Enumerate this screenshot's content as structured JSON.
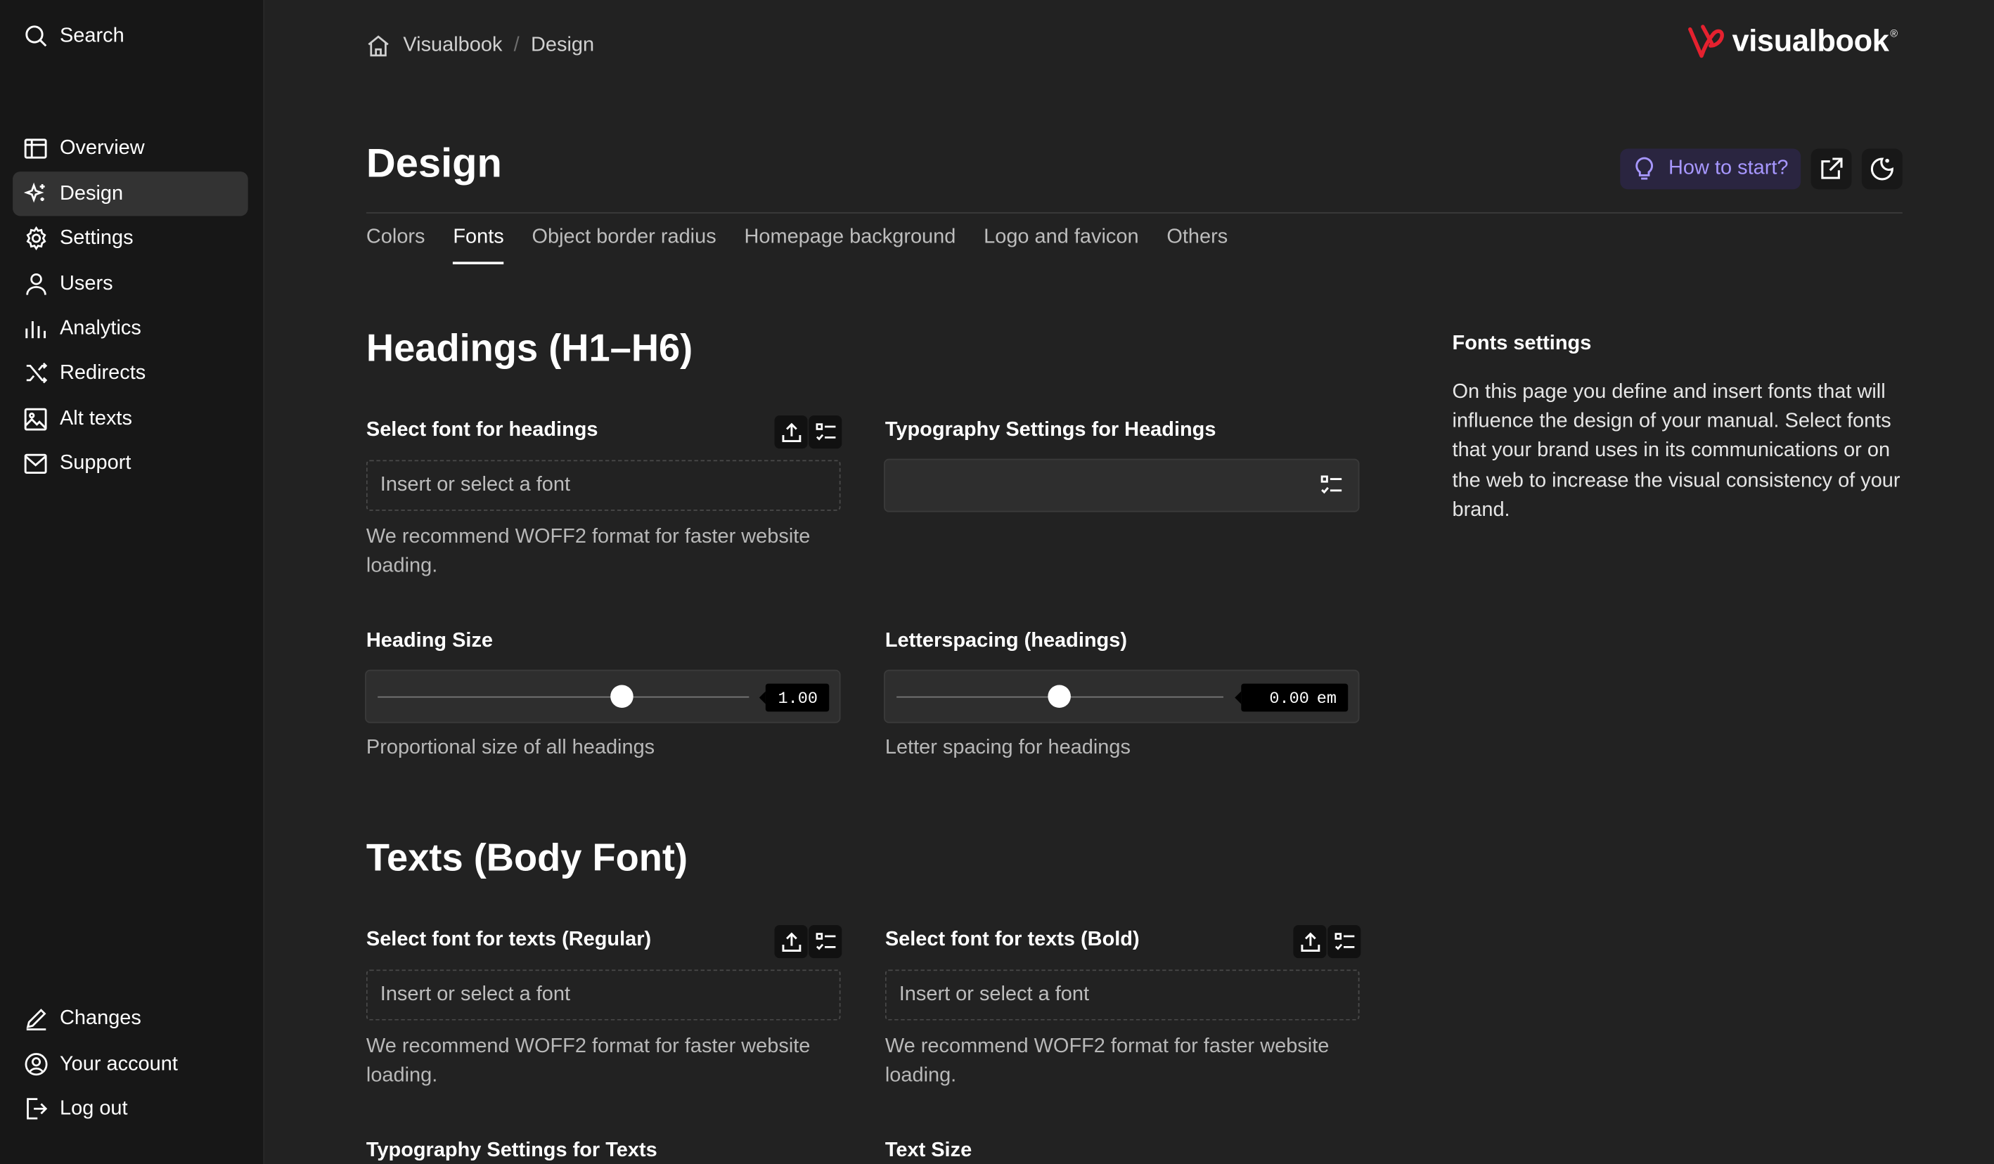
{
  "sidebar": {
    "search_label": "Search",
    "nav": [
      {
        "label": "Overview",
        "icon": "overview-icon"
      },
      {
        "label": "Design",
        "icon": "sparkle-icon",
        "active": true
      },
      {
        "label": "Settings",
        "icon": "gear-icon"
      },
      {
        "label": "Users",
        "icon": "user-icon"
      },
      {
        "label": "Analytics",
        "icon": "bar-chart-icon"
      },
      {
        "label": "Redirects",
        "icon": "shuffle-icon"
      },
      {
        "label": "Alt texts",
        "icon": "image-icon"
      },
      {
        "label": "Support",
        "icon": "mail-icon"
      }
    ],
    "bottom": [
      {
        "label": "Changes",
        "icon": "pencil-icon"
      },
      {
        "label": "Your account",
        "icon": "account-icon"
      },
      {
        "label": "Log out",
        "icon": "logout-icon"
      }
    ]
  },
  "breadcrumb": {
    "root": "Visualbook",
    "current": "Design"
  },
  "brand": {
    "name": "visualbook",
    "mark": "®",
    "accent": "#e5212f"
  },
  "header": {
    "title": "Design",
    "howto_label": "How to start?",
    "howto_color": "#a797ff"
  },
  "tabs": [
    {
      "label": "Colors"
    },
    {
      "label": "Fonts",
      "active": true
    },
    {
      "label": "Object border radius"
    },
    {
      "label": "Homepage background"
    },
    {
      "label": "Logo and favicon"
    },
    {
      "label": "Others"
    }
  ],
  "headings": {
    "title": "Headings (H1–H6)",
    "font_label": "Select font for headings",
    "font_placeholder": "Insert or select a font",
    "font_help": "We recommend WOFF2 format for faster website loading.",
    "typo_label": "Typography Settings for Headings",
    "size_label": "Heading Size",
    "size_value": "1.00",
    "size_help": "Proportional size of all headings",
    "spacing_label": "Letterspacing (headings)",
    "spacing_value": "0.00",
    "spacing_unit": "em",
    "spacing_help": "Letter spacing for headings"
  },
  "texts": {
    "title": "Texts (Body Font)",
    "regular_label": "Select font for texts (Regular)",
    "regular_placeholder": "Insert or select a font",
    "regular_help": "We recommend WOFF2 format for faster website loading.",
    "bold_label": "Select font for texts (Bold)",
    "bold_placeholder": "Insert or select a font",
    "bold_help": "We recommend WOFF2 format for faster website loading.",
    "typo_label": "Typography Settings for Texts",
    "size_label": "Text Size"
  },
  "aside": {
    "title": "Fonts settings",
    "text": "On this page you define and insert fonts that will influence the design of your manual. Select fonts that your brand uses in its communications or on the web to increase the visual consistency of your brand."
  }
}
